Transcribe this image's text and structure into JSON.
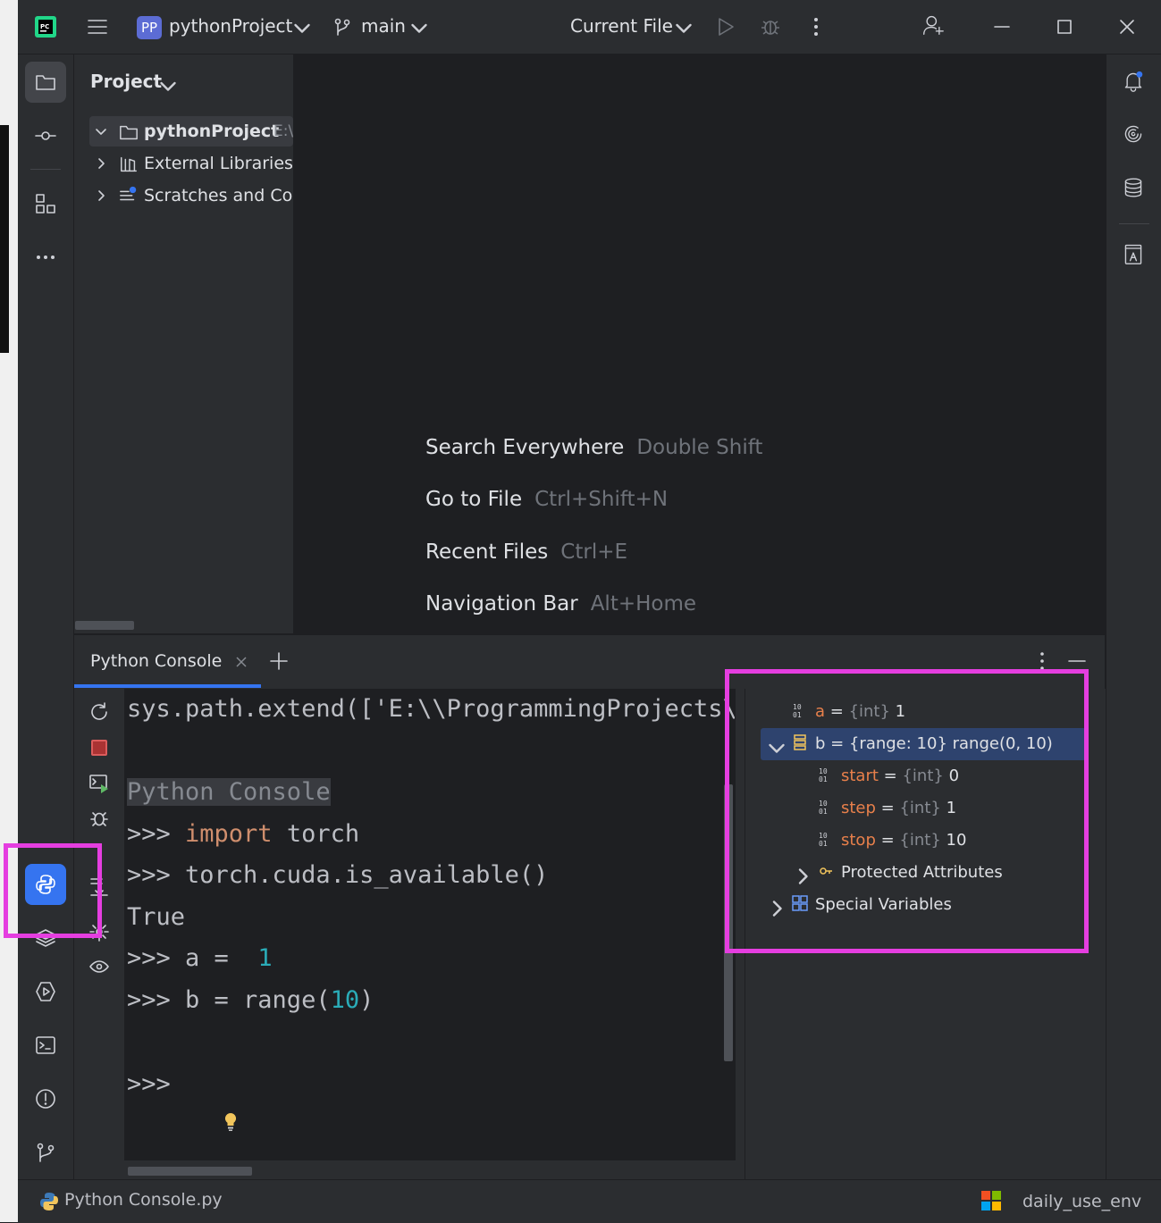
{
  "titlebar": {
    "project_badge": "PP",
    "project_name": "pythonProject",
    "branch": "main",
    "run_config": "Current File"
  },
  "project_panel": {
    "title": "Project",
    "tree": [
      {
        "label": "pythonProject",
        "hint": "E:\\",
        "expanded": true
      },
      {
        "label": "External Libraries",
        "expanded": false
      },
      {
        "label": "Scratches and Cor",
        "expanded": false
      }
    ]
  },
  "editor_hints": [
    {
      "action": "Search Everywhere",
      "shortcut": "Double Shift"
    },
    {
      "action": "Go to File",
      "shortcut": "Ctrl+Shift+N"
    },
    {
      "action": "Recent Files",
      "shortcut": "Ctrl+E"
    },
    {
      "action": "Navigation Bar",
      "shortcut": "Alt+Home"
    }
  ],
  "console": {
    "tab_label": "Python Console",
    "lines": {
      "l1": "sys.path.extend(['E:\\\\ProgrammingProjects\\\\",
      "l2": "Python Console",
      "p3": ">>> ",
      "k3": "import",
      "r3": " torch",
      "l4": ">>> torch.cuda.is_available()",
      "l5": "True",
      "p6": ">>> a =  ",
      "n6": "1",
      "p7": ">>> b = range(",
      "n7": "10",
      "e7": ")",
      "l8": ">>>"
    }
  },
  "variables": {
    "a": {
      "name": "a",
      "eq": " = ",
      "type": "{int}",
      "value": " 1"
    },
    "b": {
      "name": "b",
      "text": " = {range: 10} range(0, 10)"
    },
    "start": {
      "name": "start",
      "eq": " = ",
      "type": "{int}",
      "value": " 0"
    },
    "step": {
      "name": "step",
      "eq": " = ",
      "type": "{int}",
      "value": " 1"
    },
    "stop": {
      "name": "stop",
      "eq": " = ",
      "type": "{int}",
      "value": " 10"
    },
    "protected": "Protected Attributes",
    "special": "Special Variables"
  },
  "statusbar": {
    "file": "Python Console.py",
    "env": "daily_use_env"
  },
  "colors": {
    "accent": "#3574f0",
    "highlight_box": "#e53ee0",
    "keyword": "#cf8e6d",
    "number": "#2aacb8",
    "var_name": "#e8804b"
  }
}
